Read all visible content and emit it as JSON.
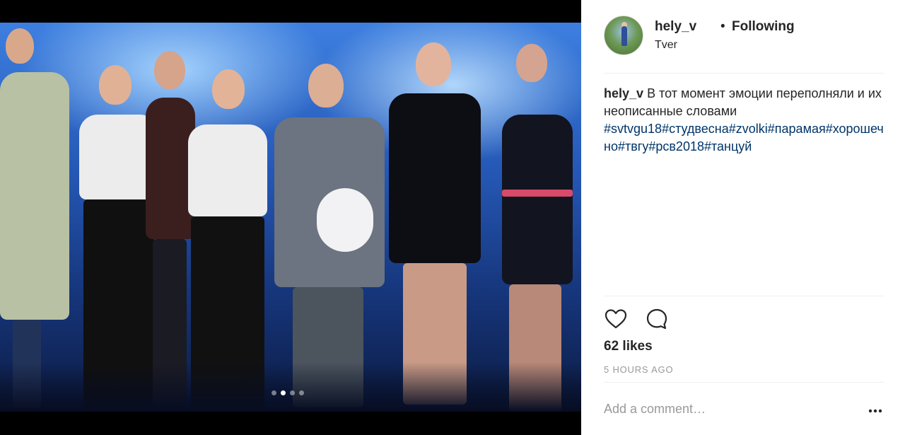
{
  "post": {
    "username": "hely_v",
    "separator": "•",
    "follow_status": "Following",
    "location": "Tver",
    "caption_user": "hely_v",
    "caption_text": "В тот момент эмоции переполняли и их неописанные словами",
    "hashtags": [
      "#svtvgu18",
      "#студвесна",
      "#zvolki",
      "#парамая",
      "#хорошечно",
      "#твгу",
      "#рсв2018",
      "#танцуй"
    ],
    "likes": "62 likes",
    "time_ago": "5 HOURS AGO",
    "comment_placeholder": "Add a comment…"
  },
  "carousel": {
    "slide_count": 4,
    "active_index": 1
  },
  "icons": {
    "like": "heart-outline-icon",
    "comment": "speech-bubble-icon",
    "options": "more-options-icon"
  },
  "colors": {
    "text": "#262626",
    "hashtag": "#003569",
    "muted": "#999999",
    "divider": "#efefef"
  }
}
